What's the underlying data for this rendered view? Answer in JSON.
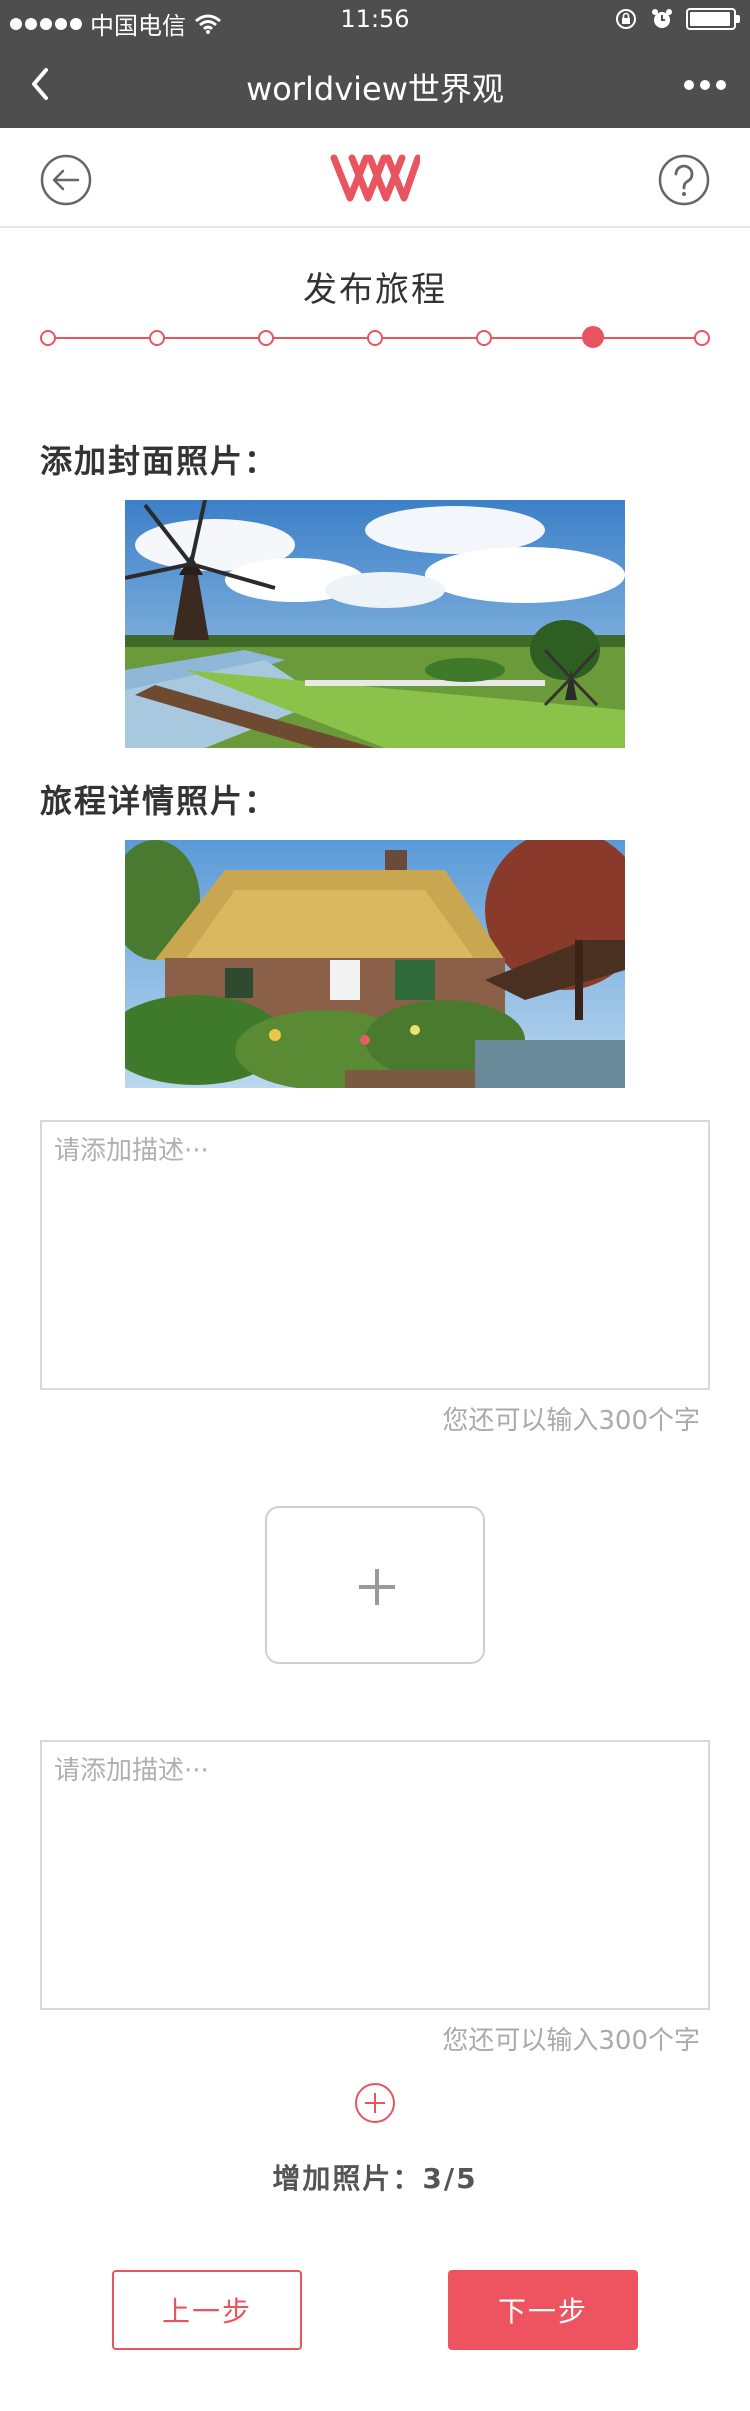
{
  "status": {
    "carrier": "中国电信",
    "time": "11:56"
  },
  "nav": {
    "title": "worldview世界观"
  },
  "page": {
    "title": "发布旅程"
  },
  "steps": {
    "count": 7,
    "active_index": 5
  },
  "sections": {
    "cover_label": "添加封面照片：",
    "detail_label": "旅程详情照片："
  },
  "descriptions": [
    {
      "placeholder": "请添加描述···",
      "value": "",
      "hint": "您还可以输入300个字"
    },
    {
      "placeholder": "请添加描述···",
      "value": "",
      "hint": "您还可以输入300个字"
    }
  ],
  "photo_count": "增加照片：3/5",
  "buttons": {
    "prev": "上一步",
    "next": "下一步"
  },
  "colors": {
    "accent": "#e85560",
    "bar": "#4e4e4e"
  },
  "icons": [
    "wifi-icon",
    "back-icon",
    "more-icon",
    "back-circle-icon",
    "logo-icon",
    "help-icon",
    "plus-icon",
    "add-circle-icon",
    "alarm-icon",
    "lock-rotation-icon",
    "battery-icon"
  ]
}
